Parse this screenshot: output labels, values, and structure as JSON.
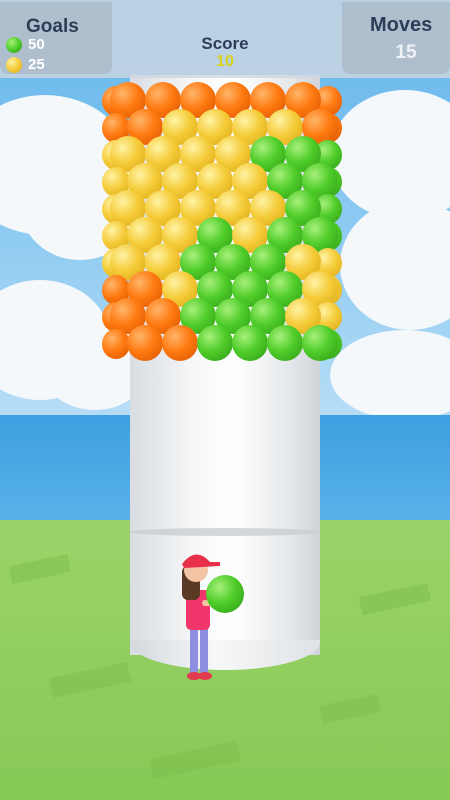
{
  "hud": {
    "goals_label": "Goals",
    "goals": [
      {
        "color": "green",
        "count": "50"
      },
      {
        "color": "yellow",
        "count": "25"
      }
    ],
    "score_label": "Score",
    "score_value": "10",
    "moves_label": "Moves",
    "moves_value": "15"
  },
  "colors": {
    "green": "#4fcd2a",
    "yellow": "#f5cc3a",
    "orange": "#ff7a10",
    "score_value": "#d8d21c",
    "hud_text": "#2c3e57"
  },
  "held_ball_color": "green",
  "tower_rows": [
    [
      "orange",
      "orange",
      "orange",
      "orange",
      "orange",
      "orange"
    ],
    [
      "orange",
      "yellow",
      "yellow",
      "yellow",
      "yellow",
      "orange"
    ],
    [
      "yellow",
      "yellow",
      "yellow",
      "yellow",
      "green",
      "green"
    ],
    [
      "yellow",
      "yellow",
      "yellow",
      "yellow",
      "green",
      "green"
    ],
    [
      "yellow",
      "yellow",
      "yellow",
      "yellow",
      "yellow",
      "green"
    ],
    [
      "yellow",
      "yellow",
      "green",
      "yellow",
      "green",
      "green"
    ],
    [
      "yellow",
      "yellow",
      "green",
      "green",
      "green",
      "yellow"
    ],
    [
      "orange",
      "yellow",
      "green",
      "green",
      "green",
      "yellow"
    ],
    [
      "orange",
      "orange",
      "green",
      "green",
      "green",
      "yellow"
    ],
    [
      "orange",
      "orange",
      "green",
      "green",
      "green",
      "green"
    ]
  ]
}
